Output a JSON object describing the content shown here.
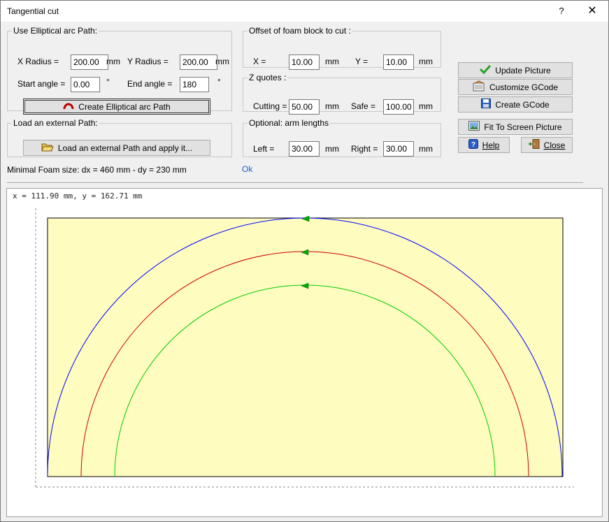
{
  "window": {
    "title": "Tangential cut",
    "help_glyph": "?",
    "close_glyph": "✕"
  },
  "elliptical": {
    "legend": "Use Elliptical arc Path:",
    "x_radius_label": "X Radius =",
    "x_radius_value": "200.00",
    "y_radius_label": "Y Radius =",
    "y_radius_value": "200.00",
    "unit_mm": "mm",
    "start_angle_label": "Start angle =",
    "start_angle_value": "0.00",
    "end_angle_label": "End angle =",
    "end_angle_value": "180",
    "degree": "°",
    "create_button": "Create Elliptical arc Path"
  },
  "external": {
    "legend": "Load an external Path:",
    "load_button": "Load an external Path and apply it..."
  },
  "offset": {
    "legend": "Offset of foam block to cut :",
    "x_label": "X =",
    "x_value": "10.00",
    "y_label": "Y =",
    "y_value": "10.00",
    "unit_mm": "mm"
  },
  "zquotes": {
    "legend": "Z quotes :",
    "cutting_label": "Cutting =",
    "cutting_value": "50.00",
    "safe_label": "Safe =",
    "safe_value": "100.00",
    "unit_mm": "mm"
  },
  "arms": {
    "legend": "Optional: arm lengths",
    "left_label": "Left =",
    "left_value": "30.00",
    "right_label": "Right =",
    "right_value": "30.00",
    "unit_mm": "mm"
  },
  "buttons": {
    "update_picture": "Update Picture",
    "customize_gcode": "Customize GCode",
    "create_gcode": "Create GCode",
    "fit_to_screen": "Fit To Screen Picture",
    "help": "Help",
    "close": "Close"
  },
  "status": {
    "minimal_foam": "Minimal Foam size: dx = 460 mm - dy = 230 mm",
    "ok": "Ok"
  },
  "preview": {
    "coordinates": "x = 111.90 mm, y = 162.71 mm",
    "foam_color": "#fffcc0",
    "arc_colors": [
      "#0000ff",
      "#cc0000",
      "#00cc00"
    ],
    "marker_color": "#00b000"
  }
}
